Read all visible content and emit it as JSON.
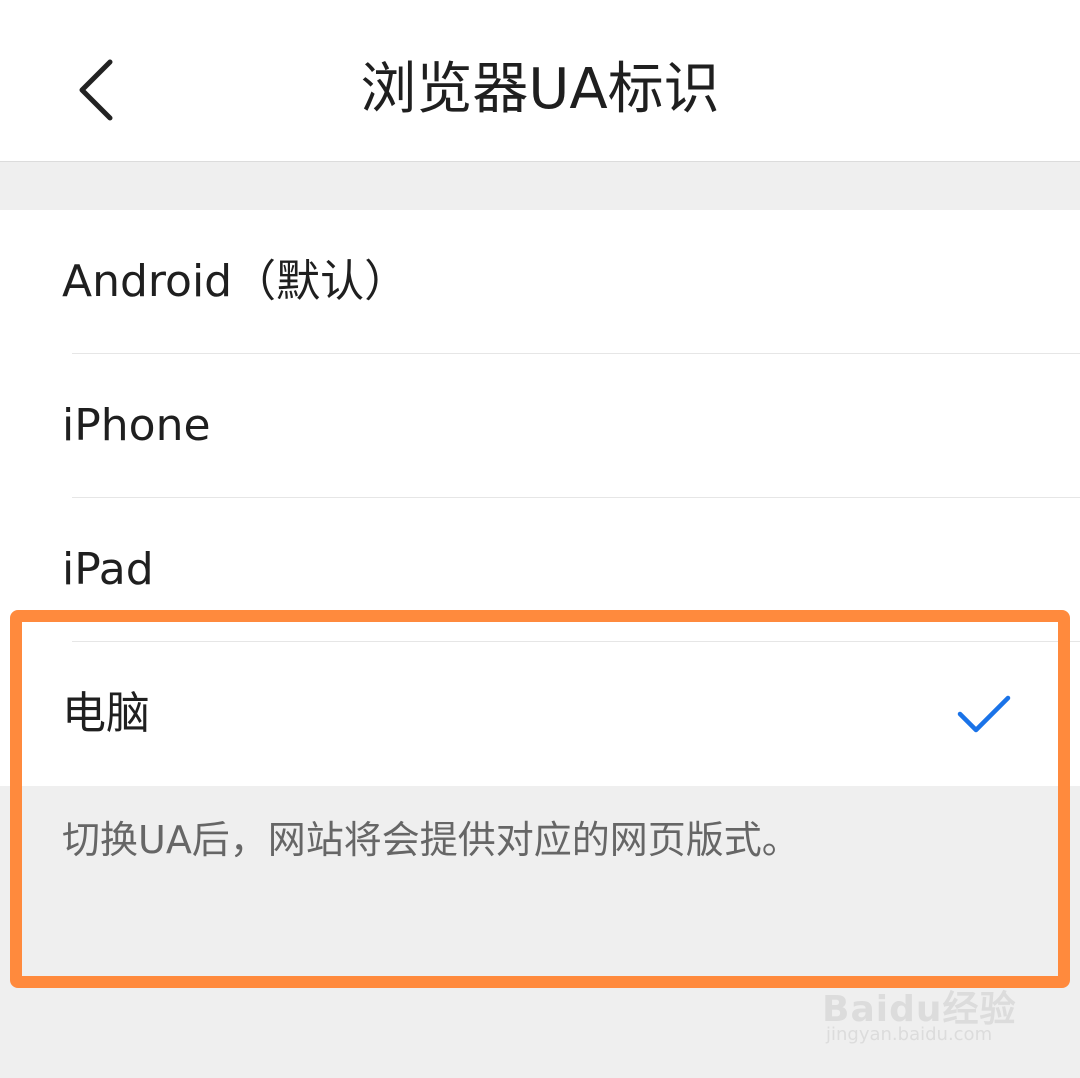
{
  "header": {
    "title": "浏览器UA标识",
    "back_icon": "chevron-left-icon"
  },
  "ua_options": [
    {
      "label": "Android（默认）",
      "selected": false
    },
    {
      "label": "iPhone",
      "selected": false
    },
    {
      "label": "iPad",
      "selected": false
    },
    {
      "label": "电脑",
      "selected": true
    }
  ],
  "hint": {
    "text": "切换UA后，网站将会提供对应的网页版式。"
  },
  "colors": {
    "accent": "#1a73e8",
    "highlight": "#ff8a3d",
    "background": "#efefef"
  },
  "watermark": {
    "brand": "Baidu经验",
    "url": "jingyan.baidu.com"
  }
}
